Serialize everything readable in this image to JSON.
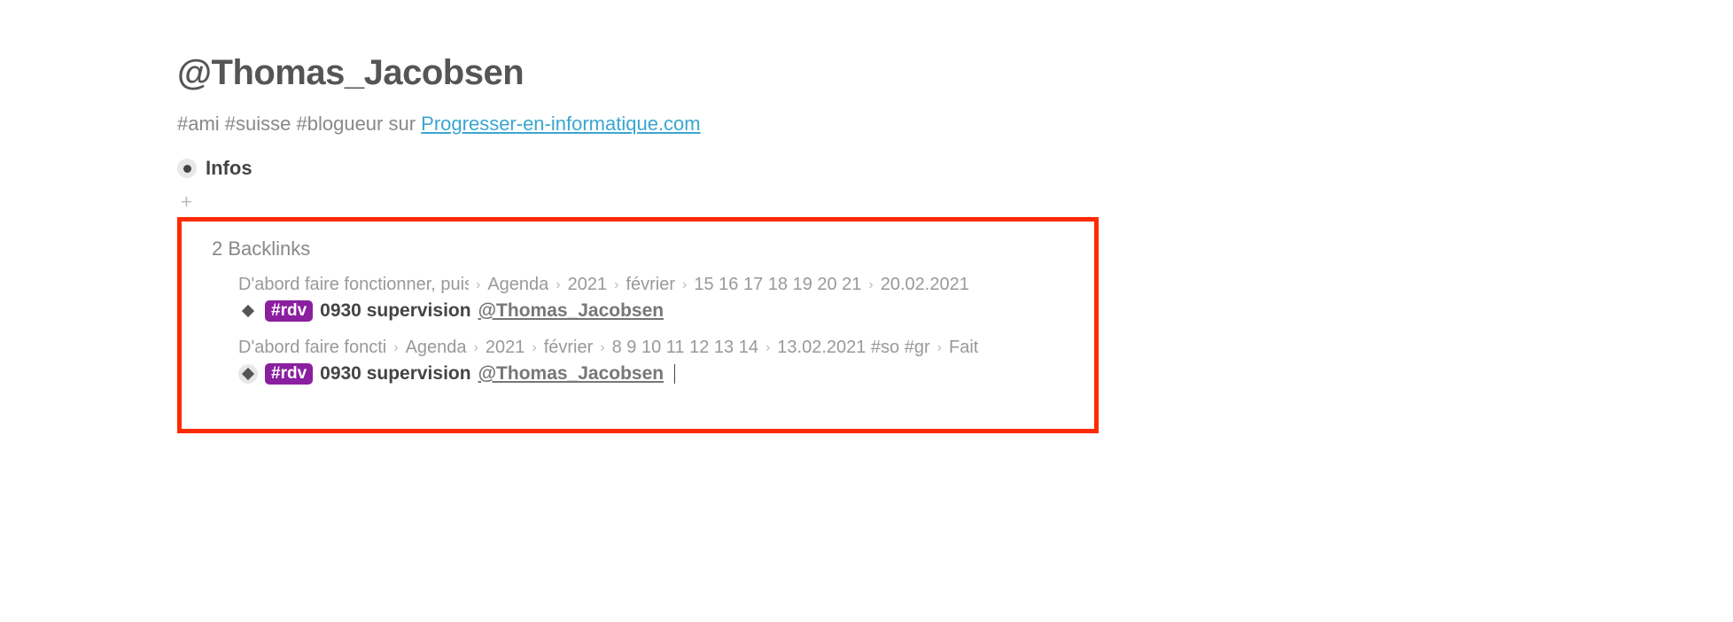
{
  "page": {
    "title": "@Thomas_Jacobsen",
    "subtitle_prefix": "#ami #suisse #blogueur sur ",
    "subtitle_link": "Progresser-en-informatique.com",
    "infos_label": "Infos",
    "plus_symbol": "+"
  },
  "backlinks": {
    "header": "2 Backlinks",
    "entries": [
      {
        "breadcrumb": [
          "D'abord faire fonctionner, puis",
          "Agenda",
          "2021",
          "février",
          "15 16 17 18 19 20 21",
          "20.02.2021"
        ],
        "tag": "#rdv",
        "text": "0930 supervision",
        "mention": "@Thomas_Jacobsen",
        "halo": false
      },
      {
        "breadcrumb": [
          "D'abord faire foncti",
          "Agenda",
          "2021",
          "février",
          "8 9 10 11 12 13 14",
          "13.02.2021 #so #gr",
          "Fait"
        ],
        "tag": "#rdv",
        "text": "0930 supervision",
        "mention": "@Thomas_Jacobsen",
        "halo": true
      }
    ]
  }
}
